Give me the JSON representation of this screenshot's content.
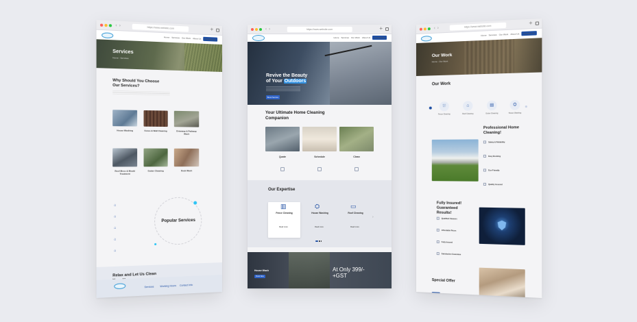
{
  "colors": {
    "background": "#eaebf0",
    "accent": "#1f4fa3",
    "outline_blue": "#3a9bd6",
    "cyan": "#2ec4f5"
  },
  "left": {
    "url": "https://www.website.com",
    "nav": [
      "Home",
      "Services",
      "Our Work",
      "About Us"
    ],
    "nav_button": "Contact Us",
    "hero_title": "Services",
    "breadcrumb": "Home - Services",
    "why_title": "Why Should You Choose Our Services?",
    "services": [
      "House Washing",
      "Fence & Wall Cleaning",
      "Driveway & Pathway Wash",
      "Roof Moss & Mould Treatment",
      "Gutter Cleaning",
      "Deck Wash"
    ],
    "popular_title": "Popular Services",
    "cta_title": "Relax and Let Us Clean Your Home",
    "cta_button": "Book Now",
    "footer_links": [
      "Services",
      "Working Hours",
      "Contact Info"
    ]
  },
  "center": {
    "url": "https://www.website.com",
    "nav": [
      "Home",
      "Services",
      "Our Work",
      "About Us"
    ],
    "nav_button": "Contact Us",
    "hero_title_line1": "Revive the Beauty",
    "hero_title_line2_pre": "of Your ",
    "hero_title_highlight": "Outdoors",
    "hero_button": "Book Service",
    "companion_title": "Your Ultimate Home Cleaning Companion",
    "steps": [
      "Quote",
      "Schedule",
      "Clean"
    ],
    "expertise_title": "Our Expertise",
    "expertise": [
      "Fence Cleaning",
      "House Washing",
      "Roof Cleaning"
    ],
    "read_more": "Read more",
    "promo_label": "House Wash",
    "promo_button": "Book Now",
    "promo_price": "At Only 399/- +GST"
  },
  "right": {
    "url": "https://www.website.com",
    "nav": [
      "Home",
      "Services",
      "Our Work",
      "About Us"
    ],
    "nav_button": "Contact Us",
    "hero_title": "Our Work",
    "breadcrumb": "Home - Our Work",
    "section_title": "Our Work",
    "icons": [
      "Fence Cleaning",
      "Roof Cleaning",
      "Gutter Cleaning",
      "House Washing"
    ],
    "professional_title": "Professional Home Cleaning!",
    "features": [
      "Safety & Reliability",
      "Easy Booking",
      "Eco-Friendly",
      "Quality Assured"
    ],
    "insured_title": "Fully Insured! Guaranteed Results!",
    "guarantees": [
      "Qualified Cleaners",
      "Affordable Prices",
      "Fully Insured",
      "Satisfaction Guarantee"
    ],
    "special_title": "Special Offer",
    "special_button": "Book Now"
  }
}
